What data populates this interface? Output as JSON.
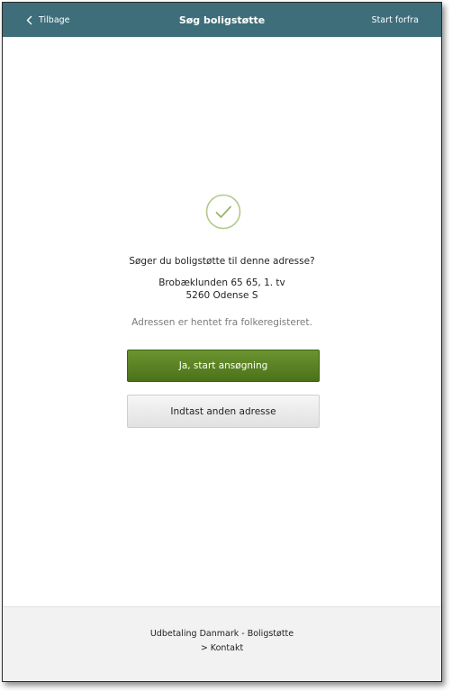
{
  "header": {
    "back_label": "Tilbage",
    "title": "Søg boligstøtte",
    "start_label": "Start forfra",
    "background": "#3e6e7a"
  },
  "main": {
    "status_icon": "check-circle-icon",
    "question": "Søger du boligstøtte til denne adresse?",
    "address_line1": "Brobæklunden 65 65, 1. tv",
    "address_line2": "5260 Odense S",
    "note": "Adressen er hentet fra folkeregisteret.",
    "primary_button": "Ja, start ansøgning",
    "secondary_button": "Indtast anden adresse",
    "accent": "#5a8224"
  },
  "footer": {
    "org": "Udbetaling Danmark - Boligstøtte",
    "contact_link": "> Kontakt"
  }
}
